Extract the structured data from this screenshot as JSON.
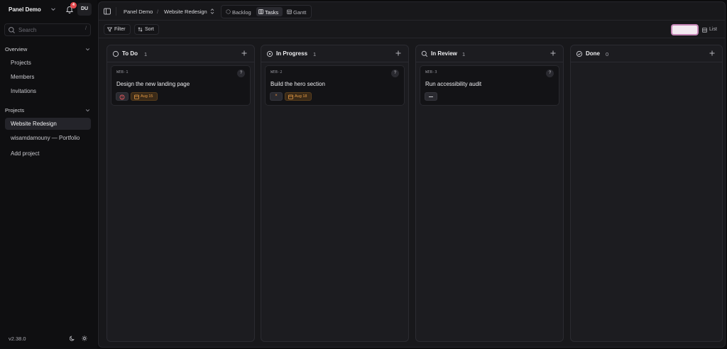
{
  "workspace": {
    "name": "Panel Demo",
    "notifications": "4",
    "avatar_initials": "DU"
  },
  "search": {
    "placeholder": "Search",
    "shortcut": "/"
  },
  "sidebar": {
    "overview": {
      "label": "Overview",
      "items": [
        "Projects",
        "Members",
        "Invitations"
      ]
    },
    "projects": {
      "label": "Projects",
      "items": [
        "Website Redesign",
        "wisamdamouny — Portfolio",
        "Add project"
      ],
      "active": "Website Redesign"
    },
    "version": "v2.38.0"
  },
  "header": {
    "breadcrumb": [
      "Panel Demo",
      "Website Redesign"
    ],
    "breadcrumb_separator": "/",
    "views": [
      "Backlog",
      "Tasks",
      "Gantt"
    ],
    "active_view": "Tasks"
  },
  "toolbar": {
    "filter_label": "Filter",
    "sort_label": "Sort",
    "list_label": "List"
  },
  "columns": [
    {
      "title": "To Do",
      "count": "1",
      "status_icon": "circle-icon",
      "cards": [
        {
          "key": "WEB-1",
          "title": "Design the new landing page",
          "priority_icon": "urgent-priority-icon",
          "due": "Aug 15"
        }
      ]
    },
    {
      "title": "In Progress",
      "count": "1",
      "status_icon": "in-progress-icon",
      "cards": [
        {
          "key": "WEB-2",
          "title": "Build the hero section",
          "priority_icon": "high-priority-icon",
          "priority_mark": "×",
          "due": "Aug 18"
        }
      ]
    },
    {
      "title": "In Review",
      "count": "1",
      "status_icon": "search-icon",
      "cards": [
        {
          "key": "WEB-3",
          "title": "Run accessibility audit",
          "priority_icon": "no-priority-icon"
        }
      ]
    },
    {
      "title": "Done",
      "count": "0",
      "status_icon": "check-circle-icon",
      "cards": []
    }
  ],
  "card_help": "?",
  "colors": {
    "accent_pink": "#f3e9f1",
    "due_orange": "#e59a44",
    "badge_red": "#e5484d"
  }
}
